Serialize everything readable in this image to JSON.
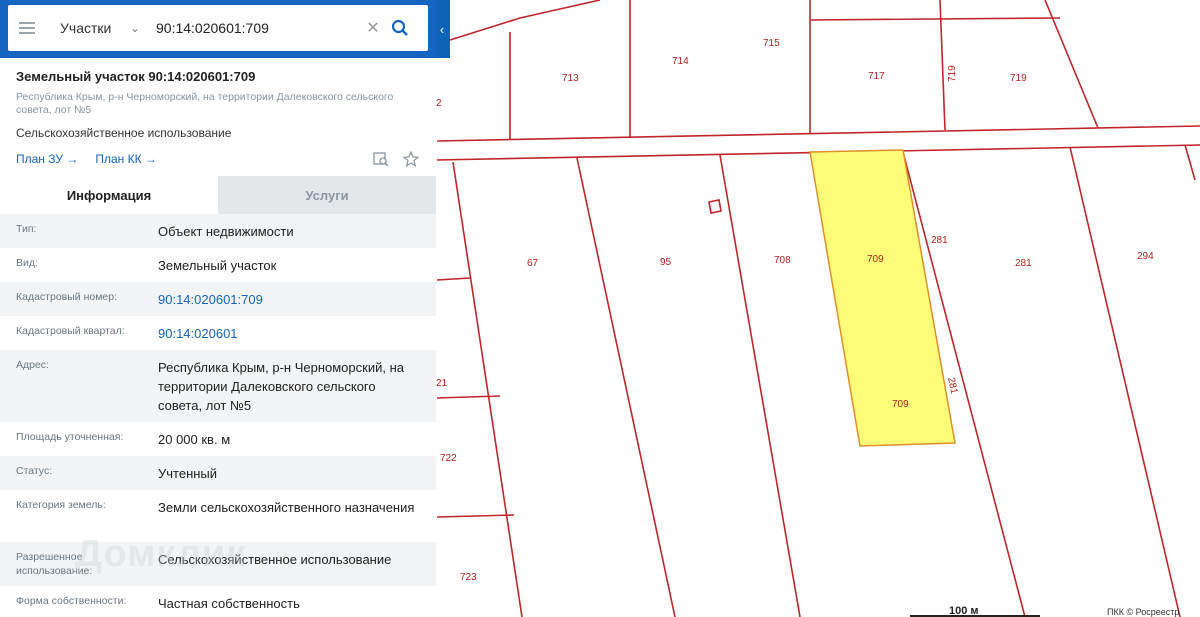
{
  "search": {
    "type_label": "Участки",
    "query_value": "90:14:020601:709",
    "placeholder": ""
  },
  "parcel": {
    "title": "Земельный участок 90:14:020601:709",
    "address_short": "Республика Крым, р-н Черноморский, на территории Далековского сельского совета, лот №5",
    "usage": "Сельскохозяйственное использование",
    "link_plan_zu": "План ЗУ →",
    "link_plan_kk": "План КК →"
  },
  "tabs": [
    "Информация",
    "Услуги"
  ],
  "info_rows": [
    {
      "key": "Тип:",
      "value": "Объект недвижимости",
      "link": false
    },
    {
      "key": "Вид:",
      "value": "Земельный участок",
      "link": false
    },
    {
      "key": "Кадастровый номер:",
      "value": "90:14:020601:709",
      "link": true
    },
    {
      "key": "Кадастровый квартал:",
      "value": "90:14:020601",
      "link": true
    },
    {
      "key": "Адрес:",
      "value": "Республика Крым, р-н Черноморский, на территории Далековского сельского совета, лот №5",
      "link": false
    },
    {
      "key": "Площадь уточненная:",
      "value": "20 000 кв. м",
      "link": false
    },
    {
      "key": "Статус:",
      "value": "Учтенный",
      "link": false
    },
    {
      "key": "Категория земель:",
      "value": "Земли сельскохозяйственного назначения",
      "link": false
    },
    {
      "key": "Разрешенное использование:",
      "value": "Сельскохозяйственное использование",
      "link": false
    },
    {
      "key": "Форма собственности:",
      "value": "Частная собственность",
      "link": false
    }
  ],
  "watermark": "Домклик",
  "map": {
    "parcel_labels": [
      "713",
      "714",
      "715",
      "717",
      "719",
      "719",
      "67",
      "95",
      "708",
      "709",
      "281",
      "281",
      "294",
      "709",
      "281",
      "722",
      "723",
      "21",
      "2"
    ],
    "scale_label": "100 м",
    "copyright": "ПКК © Росреестр",
    "highlight_color": "#fdfd7a",
    "boundary_color": "#c0262c"
  }
}
